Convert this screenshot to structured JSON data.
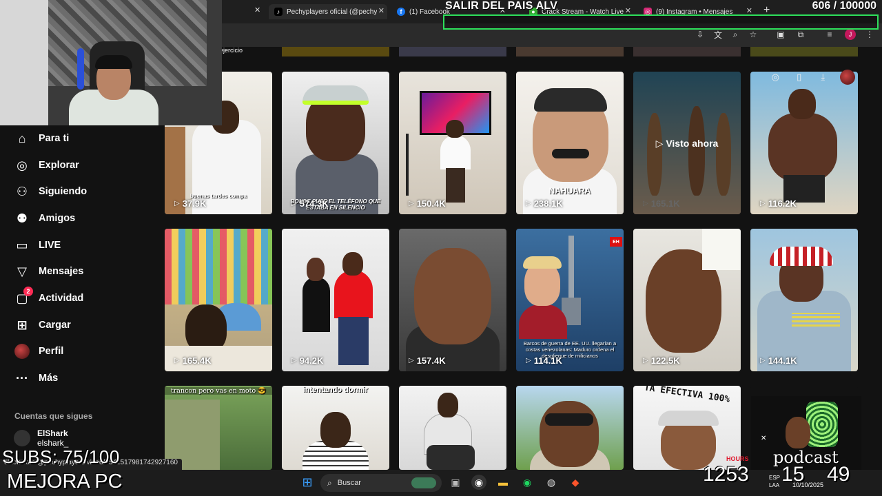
{
  "browser": {
    "tabs": [
      {
        "label": "Pechyplayers oficial (@pechy",
        "favicon": "tiktok-icon",
        "active": true
      },
      {
        "label": "(1) Facebook",
        "favicon": "facebook-icon",
        "active": false
      },
      {
        "label": "Crack Stream - Watch Live",
        "favicon": "globe-icon",
        "active": false
      },
      {
        "label": "(9) Instagram • Mensajes",
        "favicon": "instagram-icon",
        "active": false
      }
    ],
    "profile_initial": "J",
    "status_url": "tiktok.com/@pechyplayers/video/7541517981742927160"
  },
  "overlay": {
    "title": "SALIR DEL PAIS ALV",
    "goal_count": "606  / 100000",
    "subs": "SUBS: 75/100",
    "mejora": "MEJORA PC",
    "timer": {
      "a": "1253",
      "b": "15",
      "c": "49"
    },
    "hours_label": "HOURS",
    "podcast": "podcast"
  },
  "sidebar": {
    "items": [
      {
        "label": "Para ti",
        "icon": "home-icon"
      },
      {
        "label": "Explorar",
        "icon": "compass-icon"
      },
      {
        "label": "Siguiendo",
        "icon": "user-plus-icon"
      },
      {
        "label": "Amigos",
        "icon": "friends-icon"
      },
      {
        "label": "LIVE",
        "icon": "live-tv-icon"
      },
      {
        "label": "Mensajes",
        "icon": "send-icon"
      },
      {
        "label": "Actividad",
        "icon": "inbox-icon",
        "badge": "2"
      },
      {
        "label": "Cargar",
        "icon": "plus-square-icon"
      },
      {
        "label": "Perfil",
        "icon": "avatar"
      },
      {
        "label": "Más",
        "icon": "more-icon"
      }
    ],
    "following_title": "Cuentas que sigues",
    "following": [
      {
        "name": "ElShark",
        "handle": "elshark_"
      }
    ]
  },
  "grid": {
    "top_caption": "ejercicio",
    "row1": [
      {
        "views": "37.9K",
        "caption": "buenas tardes compa"
      },
      {
        "views": "574.3K",
        "caption": "DONDE PUSE EL TELÉFONO QUE ESTABA EN SILENCIO"
      },
      {
        "views": "150.4K",
        "caption": ""
      },
      {
        "views": "238.1K",
        "caption": "NAHUARA"
      },
      {
        "views": "165.1K",
        "caption": "",
        "watched": "Visto ahora"
      },
      {
        "views": "116.2K",
        "caption": ""
      }
    ],
    "row2": [
      {
        "views": "165.4K",
        "caption": ""
      },
      {
        "views": "94.2K",
        "caption": ""
      },
      {
        "views": "157.4K",
        "caption": ""
      },
      {
        "views": "114.1K",
        "caption": "Barcos de guerra de EE. UU. llegarían a costas venezolanas: Maduro ordena el despliegue de milicianos",
        "badge": "EH"
      },
      {
        "views": "122.5K",
        "caption": ""
      },
      {
        "views": "144.1K",
        "caption": ""
      }
    ],
    "row3": [
      {
        "caption": "trancon pero vas en moto 😎"
      },
      {
        "caption": "intentando dormir"
      },
      {
        "caption": ""
      },
      {
        "caption": ""
      },
      {
        "caption": "TA EFECTIVA 100%"
      },
      {
        "caption": ""
      }
    ]
  },
  "taskbar": {
    "search_placeholder": "Buscar",
    "lang": "ESP",
    "lang2": "LAA",
    "date": "10/10/2025"
  }
}
